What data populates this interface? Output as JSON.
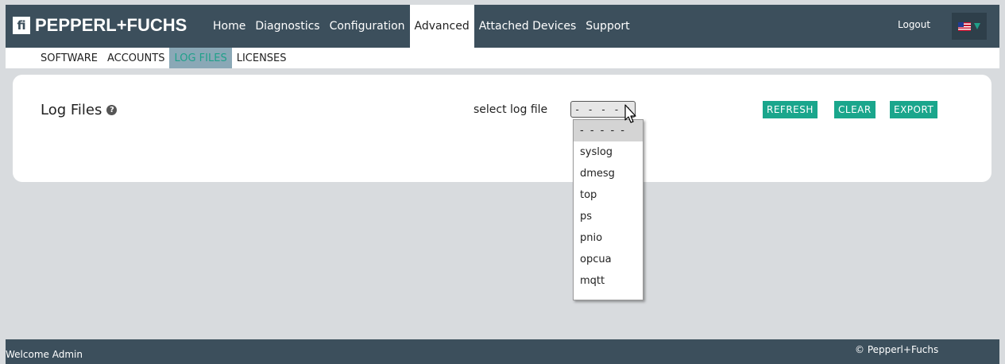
{
  "header": {
    "logo_mark": "fi",
    "logo_text": "PEPPERL+FUCHS",
    "nav": [
      {
        "label": "Home"
      },
      {
        "label": "Diagnostics"
      },
      {
        "label": "Configuration"
      },
      {
        "label": "Advanced",
        "active": true
      },
      {
        "label": "Attached Devices"
      },
      {
        "label": "Support"
      }
    ],
    "logout_label": "Logout",
    "language_icon": "us-flag-icon"
  },
  "subnav": {
    "items": [
      {
        "label": "SOFTWARE"
      },
      {
        "label": "ACCOUNTS"
      },
      {
        "label": "LOG FILES",
        "active": true
      },
      {
        "label": "LICENSES"
      }
    ]
  },
  "panel": {
    "title": "Log Files",
    "help_icon": "question-circle-icon",
    "select_label": "select log file",
    "select_value": "- - - - -",
    "buttons": {
      "refresh": "REFRESH",
      "clear": "CLEAR",
      "export": "EXPORT"
    }
  },
  "dropdown": {
    "options": [
      "- - - - -",
      "syslog",
      "dmesg",
      "top",
      "ps",
      "pnio",
      "opcua",
      "mqtt"
    ],
    "selected_index": 0
  },
  "footer": {
    "welcome": "Welcome Admin",
    "copyright": "© Pepperl+Fuchs"
  },
  "colors": {
    "header_bg": "#3c4f5c",
    "accent": "#1aa68c",
    "page_bg": "#d8dbde"
  }
}
